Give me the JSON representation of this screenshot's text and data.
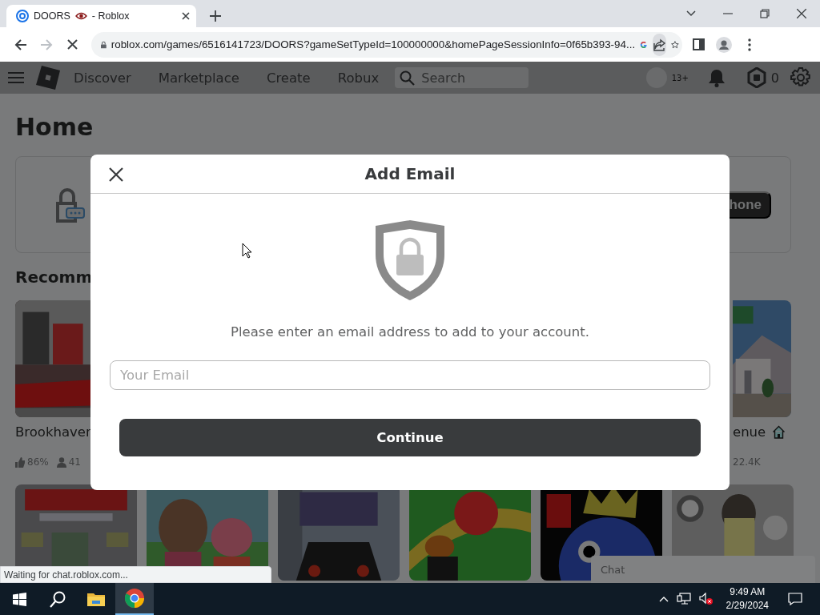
{
  "browser": {
    "tab": {
      "title": "DOORS",
      "title_suffix": "- Roblox"
    },
    "url": "roblox.com/games/6516141723/DOORS?gameSetTypeId=100000000&homePageSessionInfo=0f65b393-94..."
  },
  "nav": {
    "items": [
      "Discover",
      "Marketplace",
      "Create",
      "Robux"
    ],
    "search_placeholder": "Search",
    "age_badge": "13+",
    "robux_balance": "0"
  },
  "page": {
    "title": "Home",
    "security_card": {
      "button": "hone"
    },
    "section_title": "Recomm",
    "games_row_1": [
      {
        "title": "Brookhaven",
        "house_badge": false,
        "stats": [
          {
            "kind": "likes",
            "value": "86%"
          },
          {
            "kind": "players",
            "value": "41"
          }
        ]
      },
      {
        "title": "enue",
        "house_badge": true,
        "stats": [
          {
            "kind": "plain",
            "value": "22.4K"
          }
        ]
      }
    ],
    "chat": "Chat"
  },
  "modal": {
    "title": "Add Email",
    "message": "Please enter an email address to add to your account.",
    "email_placeholder": "Your Email",
    "button": "Continue"
  },
  "status_bubble": "Waiting for chat.roblox.com...",
  "taskbar": {
    "time": "9:49 AM",
    "date": "2/29/2024"
  }
}
